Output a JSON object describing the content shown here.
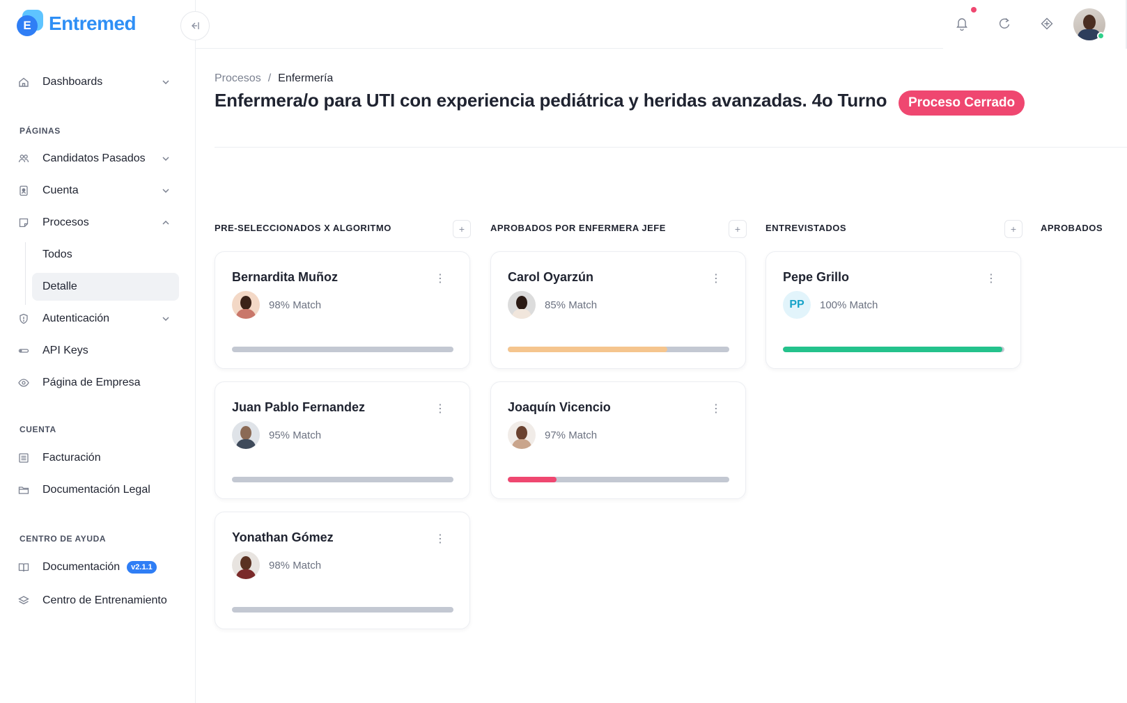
{
  "brand": {
    "name": "Entremed",
    "mark_letter": "E"
  },
  "sidebar": {
    "dashboards": "Dashboards",
    "section_paginas": "PÁGINAS",
    "candidatos": "Candidatos Pasados",
    "cuenta": "Cuenta",
    "procesos": "Procesos",
    "todos": "Todos",
    "detalle": "Detalle",
    "autenticacion": "Autenticación",
    "api_keys": "API Keys",
    "pagina_empresa": "Página de Empresa",
    "section_cuenta": "CUENTA",
    "facturacion": "Facturación",
    "documentacion_legal": "Documentación Legal",
    "section_ayuda": "CENTRO DE AYUDA",
    "documentacion": "Documentación",
    "version": "v2.1.1",
    "entrenamiento": "Centro de Entrenamiento"
  },
  "breadcrumb": {
    "parent": "Procesos",
    "sep": "/",
    "current": "Enfermería"
  },
  "page": {
    "title": "Enfermera/o para UTI con experiencia pediátrica y heridas avanzadas. 4o Turno",
    "status": "Proceso Cerrado",
    "status_color": "#ef4770"
  },
  "columns": [
    {
      "title": "PRE-SELECCIONADOS X ALGORITMO",
      "add": "+"
    },
    {
      "title": "APROBADOS POR ENFERMERA JEFE",
      "add": "+"
    },
    {
      "title": "ENTREVISTADOS",
      "add": "+"
    },
    {
      "title": "APROBADOS"
    }
  ],
  "cards": {
    "c1": {
      "name": "Bernardita Muñoz",
      "match": "98% Match",
      "progress": 0
    },
    "c2": {
      "name": "Juan Pablo Fernandez",
      "match": "95% Match",
      "progress": 0
    },
    "c3": {
      "name": "Yonathan Gómez",
      "match": "98% Match",
      "progress": 0
    },
    "c4": {
      "name": "Carol Oyarzún",
      "match": "85% Match",
      "progress": 0.72,
      "color": "#f5c58e"
    },
    "c5": {
      "name": "Joaquín Vicencio",
      "match": "97% Match",
      "progress": 0.22,
      "color": "#ef4770"
    },
    "c6": {
      "name": "Pepe Grillo",
      "initials": "PP",
      "match": "100% Match",
      "progress": 0.99,
      "color": "#24c28c"
    }
  },
  "colors": {
    "accent": "#2f7ef5",
    "notification": "#ef4770",
    "online": "#2fd08a"
  }
}
